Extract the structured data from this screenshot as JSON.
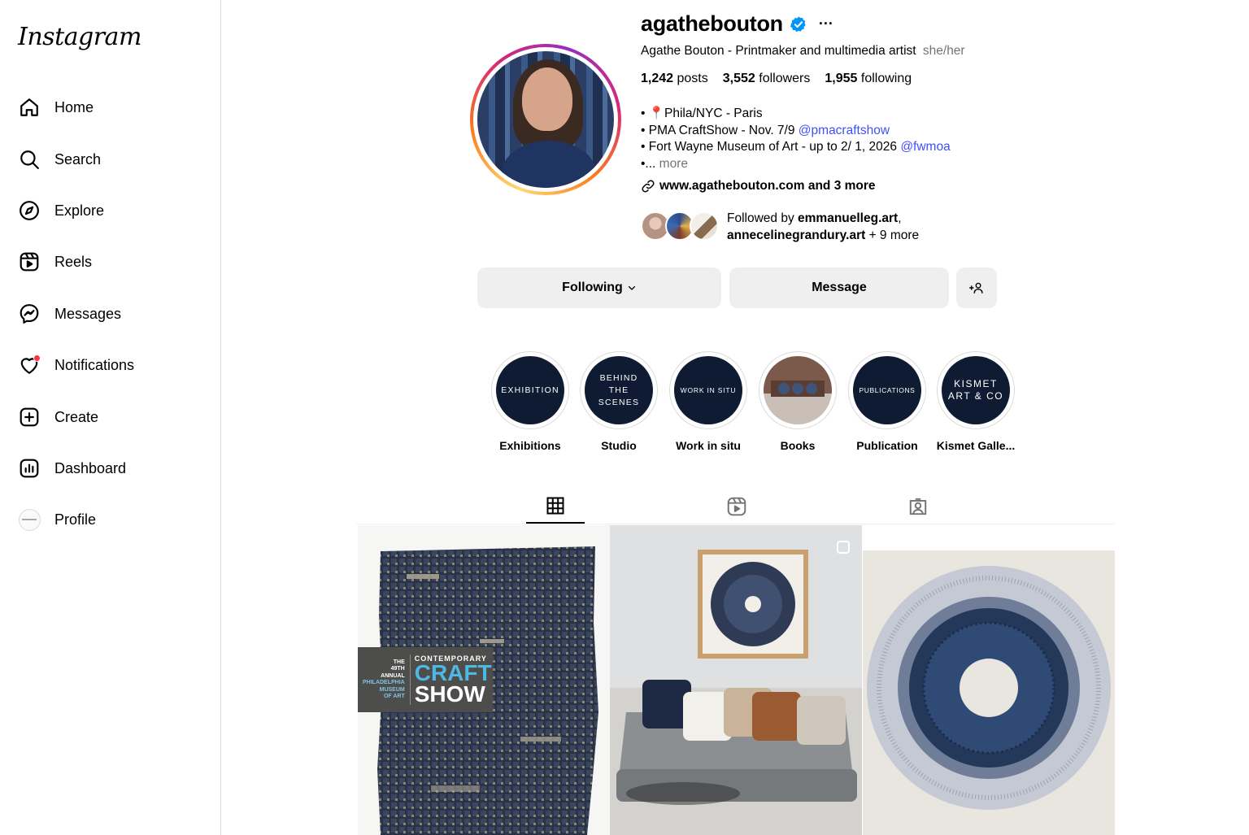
{
  "app": {
    "logo": "Instagram"
  },
  "sidebar": {
    "items": [
      {
        "label": "Home",
        "icon": "home-icon"
      },
      {
        "label": "Search",
        "icon": "search-icon"
      },
      {
        "label": "Explore",
        "icon": "compass-icon"
      },
      {
        "label": "Reels",
        "icon": "reels-icon"
      },
      {
        "label": "Messages",
        "icon": "messenger-icon"
      },
      {
        "label": "Notifications",
        "icon": "heart-icon"
      },
      {
        "label": "Create",
        "icon": "plus-square-icon"
      },
      {
        "label": "Dashboard",
        "icon": "bar-chart-icon"
      },
      {
        "label": "Profile",
        "icon": "profile-avatar"
      }
    ]
  },
  "profile": {
    "username": "agathebouton",
    "more": "···",
    "full_name": "Agathe Bouton - Printmaker and multimedia artist",
    "pronouns": "she/her",
    "stats": {
      "posts_count": "1,242",
      "posts_label": "posts",
      "followers_count": "3,552",
      "followers_label": "followers",
      "following_count": "1,955",
      "following_label": "following"
    },
    "bio": {
      "line1": "• 📍Phila/NYC - Paris",
      "line2_text": "• PMA CraftShow - Nov. 7/9 ",
      "line2_mention": "@pmacraftshow",
      "line3_text": "• Fort Wayne Museum of Art - up to 2/ 1, 2026 ",
      "line3_mention": "@fwmoa",
      "line4_text": "•... ",
      "line4_more": "more"
    },
    "link_text": "www.agathebouton.com and 3 more",
    "followed_by": {
      "prefix": "Followed by ",
      "user1": "emmanuelleg.art",
      "sep": ",",
      "user2": "annecelinegrandury.art",
      "suffix": " + 9 more"
    }
  },
  "buttons": {
    "following": "Following",
    "message": "Message",
    "add_user_glyph": "+👤"
  },
  "highlights": [
    {
      "cover": "EXHIBITION",
      "label": "Exhibitions"
    },
    {
      "cover": "BEHIND THE SCENES",
      "label": "Studio"
    },
    {
      "cover": "WORK IN SITU",
      "label": "Work in situ"
    },
    {
      "cover": "",
      "label": "Books"
    },
    {
      "cover": "PUBLICATIONS",
      "label": "Publication"
    },
    {
      "cover": "KISMET ART & CO",
      "label": "Kismet Galle..."
    }
  ],
  "tabs": [
    {
      "name": "posts",
      "icon": "grid-icon",
      "active": true
    },
    {
      "name": "reels",
      "icon": "reels-icon",
      "active": false
    },
    {
      "name": "tagged",
      "icon": "tagged-icon",
      "active": false
    }
  ],
  "posts": {
    "post1_overlay": {
      "line_a": "THE",
      "line_b": "49TH",
      "line_c": "ANNUAL",
      "line_d": "PHILADELPHIA",
      "line_e": "MUSEUM",
      "line_f": "OF ART",
      "contemporary": "CONTEMPORARY",
      "craft": "CRAFT",
      "show": "SHOW"
    }
  },
  "colors": {
    "verified_blue": "#0095f6",
    "mention_blue": "#4150f7",
    "notification_red": "#ff3040",
    "button_gray": "#efefef",
    "highlight_navy": "#0e1b33"
  }
}
